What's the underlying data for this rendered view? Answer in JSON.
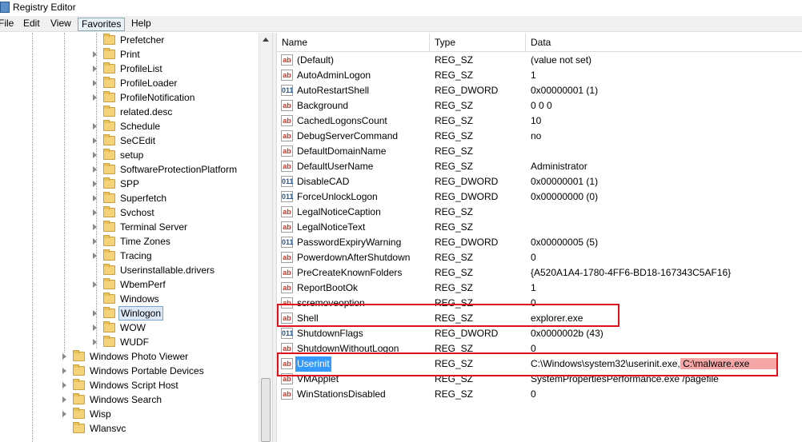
{
  "window": {
    "title": "Registry Editor"
  },
  "menu": [
    {
      "label": "File",
      "active": false
    },
    {
      "label": "Edit",
      "active": false
    },
    {
      "label": "View",
      "active": false
    },
    {
      "label": "Favorites",
      "active": true
    },
    {
      "label": "Help",
      "active": false
    }
  ],
  "tree": {
    "items": [
      {
        "label": "Prefetcher",
        "expandable": false
      },
      {
        "label": "Print",
        "expandable": true
      },
      {
        "label": "ProfileList",
        "expandable": true
      },
      {
        "label": "ProfileLoader",
        "expandable": true
      },
      {
        "label": "ProfileNotification",
        "expandable": true
      },
      {
        "label": "related.desc",
        "expandable": false
      },
      {
        "label": "Schedule",
        "expandable": true
      },
      {
        "label": "SeCEdit",
        "expandable": true
      },
      {
        "label": "setup",
        "expandable": true
      },
      {
        "label": "SoftwareProtectionPlatform",
        "expandable": true
      },
      {
        "label": "SPP",
        "expandable": true
      },
      {
        "label": "Superfetch",
        "expandable": true
      },
      {
        "label": "Svchost",
        "expandable": true
      },
      {
        "label": "Terminal Server",
        "expandable": true
      },
      {
        "label": "Time Zones",
        "expandable": true
      },
      {
        "label": "Tracing",
        "expandable": true
      },
      {
        "label": "Userinstallable.drivers",
        "expandable": false
      },
      {
        "label": "WbemPerf",
        "expandable": true
      },
      {
        "label": "Windows",
        "expandable": false
      },
      {
        "label": "Winlogon",
        "expandable": true,
        "selected": true
      },
      {
        "label": "WOW",
        "expandable": true
      },
      {
        "label": "WUDF",
        "expandable": true
      }
    ],
    "parent_items": [
      {
        "label": "Windows Photo Viewer",
        "expandable": true
      },
      {
        "label": "Windows Portable Devices",
        "expandable": true
      },
      {
        "label": "Windows Script Host",
        "expandable": true
      },
      {
        "label": "Windows Search",
        "expandable": true
      },
      {
        "label": "Wisp",
        "expandable": true
      },
      {
        "label": "Wlansvc",
        "expandable": false
      }
    ]
  },
  "columns": {
    "name": "Name",
    "type": "Type",
    "data": "Data"
  },
  "values": [
    {
      "name": "(Default)",
      "type": "REG_SZ",
      "data": "(value not set)",
      "icon": "string-value-icon"
    },
    {
      "name": "AutoAdminLogon",
      "type": "REG_SZ",
      "data": "1",
      "icon": "string-value-icon"
    },
    {
      "name": "AutoRestartShell",
      "type": "REG_DWORD",
      "data": "0x00000001 (1)",
      "icon": "dword-value-icon"
    },
    {
      "name": "Background",
      "type": "REG_SZ",
      "data": "0 0 0",
      "icon": "string-value-icon"
    },
    {
      "name": "CachedLogonsCount",
      "type": "REG_SZ",
      "data": "10",
      "icon": "string-value-icon"
    },
    {
      "name": "DebugServerCommand",
      "type": "REG_SZ",
      "data": "no",
      "icon": "string-value-icon"
    },
    {
      "name": "DefaultDomainName",
      "type": "REG_SZ",
      "data": "",
      "icon": "string-value-icon"
    },
    {
      "name": "DefaultUserName",
      "type": "REG_SZ",
      "data": "Administrator",
      "icon": "string-value-icon"
    },
    {
      "name": "DisableCAD",
      "type": "REG_DWORD",
      "data": "0x00000001 (1)",
      "icon": "dword-value-icon"
    },
    {
      "name": "ForceUnlockLogon",
      "type": "REG_DWORD",
      "data": "0x00000000 (0)",
      "icon": "dword-value-icon"
    },
    {
      "name": "LegalNoticeCaption",
      "type": "REG_SZ",
      "data": "",
      "icon": "string-value-icon"
    },
    {
      "name": "LegalNoticeText",
      "type": "REG_SZ",
      "data": "",
      "icon": "string-value-icon"
    },
    {
      "name": "PasswordExpiryWarning",
      "type": "REG_DWORD",
      "data": "0x00000005 (5)",
      "icon": "dword-value-icon"
    },
    {
      "name": "PowerdownAfterShutdown",
      "type": "REG_SZ",
      "data": "0",
      "icon": "string-value-icon"
    },
    {
      "name": "PreCreateKnownFolders",
      "type": "REG_SZ",
      "data": "{A520A1A4-1780-4FF6-BD18-167343C5AF16}",
      "icon": "string-value-icon"
    },
    {
      "name": "ReportBootOk",
      "type": "REG_SZ",
      "data": "1",
      "icon": "string-value-icon"
    },
    {
      "name": "scremoveoption",
      "type": "REG_SZ",
      "data": "0",
      "icon": "string-value-icon"
    },
    {
      "name": "Shell",
      "type": "REG_SZ",
      "data": "explorer.exe",
      "icon": "string-value-icon"
    },
    {
      "name": "ShutdownFlags",
      "type": "REG_DWORD",
      "data": "0x0000002b (43)",
      "icon": "dword-value-icon"
    },
    {
      "name": "ShutdownWithoutLogon",
      "type": "REG_SZ",
      "data": "0",
      "icon": "string-value-icon"
    },
    {
      "name": "Userinit",
      "type": "REG_SZ",
      "data": "C:\\Windows\\system32\\userinit.exe,",
      "data_highlight": " C:\\malware.exe",
      "icon": "string-value-icon",
      "selected": true
    },
    {
      "name": "VMApplet",
      "type": "REG_SZ",
      "data": "SystemPropertiesPerformance.exe /pagefile",
      "icon": "string-value-icon"
    },
    {
      "name": "WinStationsDisabled",
      "type": "REG_SZ",
      "data": "0",
      "icon": "string-value-icon"
    }
  ],
  "colors": {
    "highlight_box": "#e0101c",
    "selection": "#3399ff",
    "data_highlight": "#f4a6a6"
  }
}
